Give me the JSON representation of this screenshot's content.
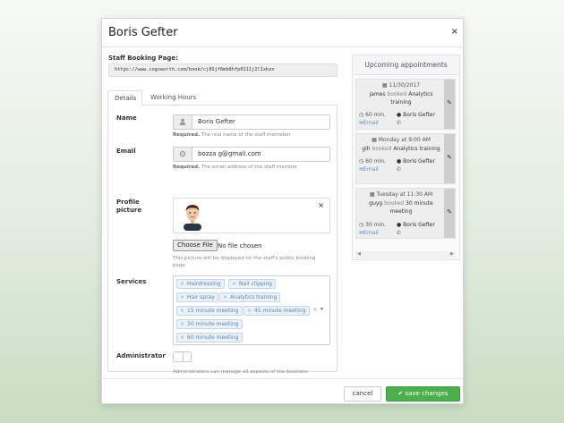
{
  "modal": {
    "title": "Boris Gefter",
    "close_glyph": "×"
  },
  "booking": {
    "label": "Staff Booking Page:",
    "url": "https://www.cogsworth.com/book/cj8Sjf6mb8hfp0111j2l1xbzn"
  },
  "tabs": [
    {
      "label": "Details",
      "active": true
    },
    {
      "label": "Working Hours",
      "active": false
    }
  ],
  "form": {
    "name": {
      "label": "Name",
      "value": "Boris Gefter",
      "help_bold": "Required.",
      "help": " The real name of the staff memeber",
      "icon": "user-icon"
    },
    "email": {
      "label": "Email",
      "value": "bozza g@gmail.com",
      "help_bold": "Required.",
      "help": " The email address of the staff member",
      "icon": "email-icon"
    },
    "picture": {
      "label_line1": "Profile",
      "label_line2": "picture",
      "remove_glyph": "×",
      "choose_label": "Choose File",
      "no_file": "No file chosen",
      "help_line1": "This picture will be displayed on the staff's public booking",
      "help_line2": "page"
    },
    "services": {
      "label": "Services",
      "tags": [
        "Hairdressing",
        "Nail clipping",
        "Hair spray",
        "Analytics training",
        "15 minute meeting",
        "45 minute meeting",
        "30 minute meeting",
        "60 minute meeting"
      ],
      "clear_glyph": "×",
      "caret_glyph": "▾"
    },
    "admin": {
      "label": "Administrator",
      "enabled": false,
      "help": "Administrators can manage all aspects of the business"
    }
  },
  "appointments": {
    "heading": "Upcoming appointments",
    "booked_word": "booked",
    "items": [
      {
        "date": "11/30/2017",
        "who": "james",
        "what_line1": "Analytics",
        "what_line2": "training",
        "duration": "60 min.",
        "staff": "Boris Gefter",
        "email_label": "Email"
      },
      {
        "date": "Monday at 9:00 AM",
        "who": "gih",
        "what_line1": "Analytics training",
        "what_line2": "",
        "duration": "60 min.",
        "staff": "Boris Gefter",
        "email_label": "Email"
      },
      {
        "date": "Tuesday at 11:30 AM",
        "who": "guyg",
        "what_line1": "30 minute",
        "what_line2": "meeting",
        "duration": "30 min.",
        "staff": "Boris Gefter",
        "email_label": "Email"
      }
    ]
  },
  "footer": {
    "cancel_label": "cancel",
    "save_label": "save changes"
  },
  "colors": {
    "accent_green": "#4cae4c",
    "tag_blue": "#5c86b3",
    "email_link": "#5b8fc6"
  }
}
